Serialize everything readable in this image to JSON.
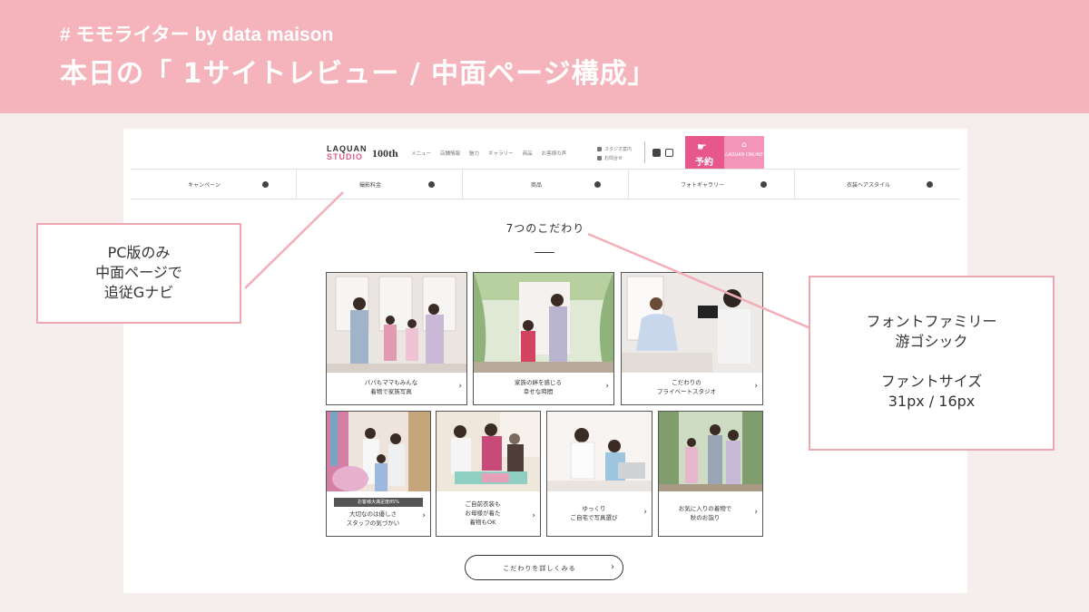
{
  "slide": {
    "hashtag": "# モモライター by data maison",
    "title": "本日の「 1サイトレビュー / 中面ページ構成」"
  },
  "site": {
    "logo_line1": "LAQUAN",
    "logo_line2": "STUDIO",
    "logo_anniv": "100th",
    "top_links": [
      "メニュー",
      "店舗情報",
      "魅力",
      "ギャラリー",
      "商品",
      "お客様の声"
    ],
    "mini_links": [
      "スタジオ案内",
      "お問合せ"
    ],
    "reserve_label": "予約",
    "online_label": "LAQUAN ONLINE",
    "gnav": [
      "キャンペーン",
      "撮影料金",
      "商品",
      "フォトギャラリー",
      "衣装ヘアスタイル"
    ],
    "section_title": "7つのこだわり",
    "cards_row1": [
      {
        "line1": "パパもママもみんな",
        "line2": "着物で家族写真"
      },
      {
        "line1": "家族の絆を感じる",
        "line2": "幸せな時間"
      },
      {
        "line1": "こだわりの",
        "line2": "プライベートスタジオ"
      }
    ],
    "cards_row2": [
      {
        "badge": "お客様大満足度85%",
        "line1": "大切なのは優しさ",
        "line2": "スタッフの気づかい",
        "line3": ""
      },
      {
        "badge": "",
        "line1": "ご自前衣装も",
        "line2": "お母様が着た",
        "line3": "着物もOK"
      },
      {
        "badge": "",
        "line1": "ゆっくり",
        "line2": "ご自宅で写真選び",
        "line3": ""
      },
      {
        "badge": "",
        "line1": "お気に入りの着物で",
        "line2": "秋のお詣り",
        "line3": ""
      }
    ],
    "more_button": "こだわりを詳しくみる"
  },
  "callouts": {
    "left": [
      "PC版のみ",
      "中面ページで",
      "追従Gナビ"
    ],
    "right": [
      "フォントファミリー",
      "游ゴシック",
      "",
      "ファントサイズ",
      "31px / 16px"
    ]
  },
  "colors": {
    "band": "#f5b4bb",
    "accent": "#e8578b",
    "callout_border": "#f0a6b0"
  }
}
